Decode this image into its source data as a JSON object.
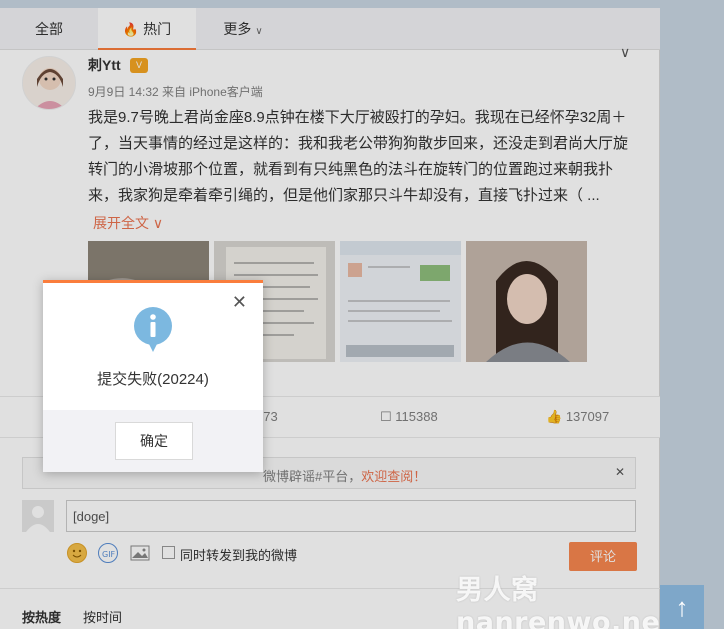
{
  "tabs": {
    "all": "全部",
    "hot": "热门",
    "more": "更多"
  },
  "post": {
    "username": "刺Ytt",
    "meta": "9月9日 14:32 来自 iPhone客户端",
    "content": "我是9.7号晚上君尚金座8.9点钟在楼下大厅被殴打的孕妇。我现在已经怀孕32周＋了，当天事情的经过是这样的：我和我老公带狗狗散步回来，还没走到君尚大厅旋转门的小滑坡那个位置，就看到有只纯黑色的法斗在旋转门的位置跑过来朝我扑来，我家狗是牵着牵引绳的，但是他们家那只斗牛却没有，直接飞扑过来（ ...",
    "expand": "展开全文"
  },
  "actions": {
    "forward_count": "973",
    "comment_count": "115388",
    "like_count": "137097"
  },
  "rumor": {
    "text": "微博辟谣#平台，",
    "welcome": "欢迎查阅！"
  },
  "comment": {
    "input_value": "[doge]",
    "repost_label": "同时转发到我的微博",
    "submit": "评论",
    "sort_hot": "按热度",
    "sort_time": "按时间"
  },
  "dialog": {
    "message": "提交失败(20224)",
    "ok": "确定"
  },
  "watermark": "男人窝nanrenwo.net",
  "colors": {
    "accent": "#fa7d3c",
    "link": "#eb7350",
    "info": "#7cb8e0"
  }
}
